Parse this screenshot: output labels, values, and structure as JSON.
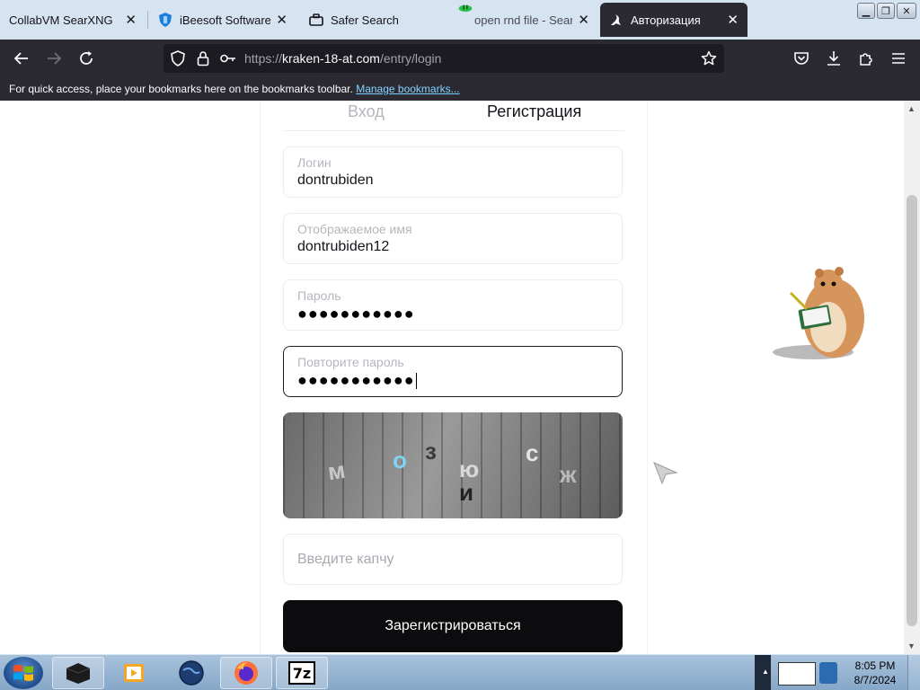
{
  "browser": {
    "tabs": [
      {
        "title": "CollabVM SearXNG",
        "active": false
      },
      {
        "title": "iBeesoft Software | D",
        "active": false
      },
      {
        "title": "Safer Search",
        "active": false
      },
      {
        "title": "open rnd file - Searc",
        "active": false
      },
      {
        "title": "Авторизация",
        "active": true
      }
    ],
    "url_scheme": "https://",
    "url_host": "kraken-18-at.com",
    "url_path": "/entry/login",
    "bookmarks_text": "For quick access, place your bookmarks here on the bookmarks toolbar.",
    "bookmarks_link": "Manage bookmarks..."
  },
  "form": {
    "tab_login": "Вход",
    "tab_register": "Регистрация",
    "login_label": "Логин",
    "login_value": "dontrubiden",
    "display_name_label": "Отображаемое имя",
    "display_name_value": "dontrubiden12",
    "password_label": "Пароль",
    "password_value": "●●●●●●●●●●●",
    "repeat_password_label": "Повторите пароль",
    "repeat_password_value": "●●●●●●●●●●●",
    "captcha_letters": [
      "м",
      "о",
      "з",
      "ю",
      "и",
      "с",
      "ж"
    ],
    "captcha_placeholder": "Введите капчу",
    "submit_label": "Зарегистрироваться"
  },
  "taskbar": {
    "time": "8:05 PM",
    "date": "8/7/2024",
    "seven_zip_label": "7z"
  },
  "colors": {
    "tab_bg": "#d6e3f1",
    "toolbar_bg": "#2b2a33",
    "submit_bg": "#0c0c0f",
    "link": "#80d3ff"
  }
}
